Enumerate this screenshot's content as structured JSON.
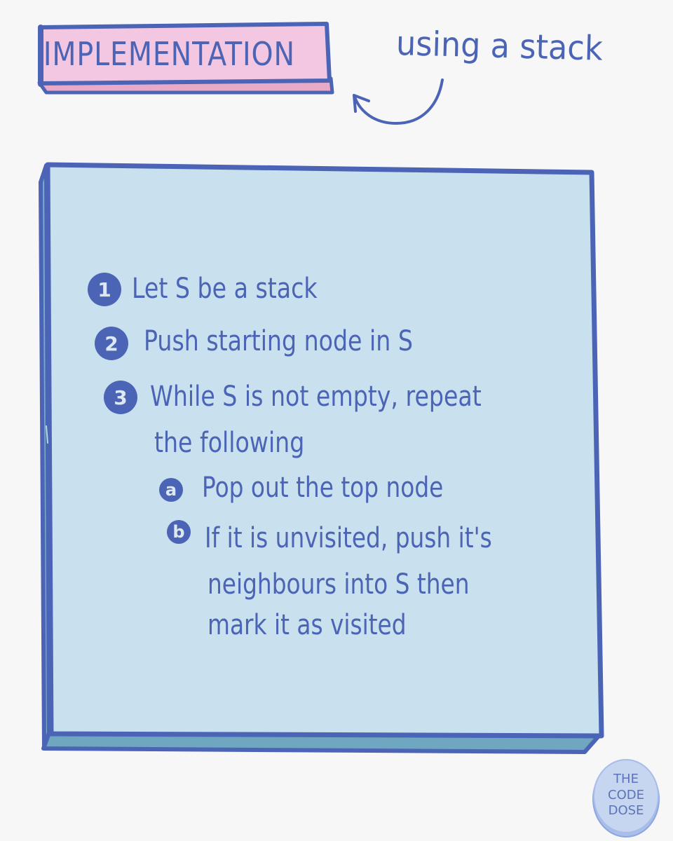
{
  "header": {
    "title": "IMPLEMENTATION",
    "subtitle": "using a stack"
  },
  "steps": [
    {
      "marker": "1",
      "lines": [
        "Let S be a stack"
      ]
    },
    {
      "marker": "2",
      "lines": [
        "Push starting node in S"
      ]
    },
    {
      "marker": "3",
      "lines": [
        "While S is not empty, repeat",
        "the following"
      ]
    }
  ],
  "substeps": [
    {
      "marker": "a",
      "lines": [
        "Pop out the top node"
      ]
    },
    {
      "marker": "b",
      "lines": [
        "If it is unvisited, push it's",
        "neighbours into S then",
        "mark it as visited"
      ]
    }
  ],
  "stamp": {
    "line1": "THE",
    "line2": "CODE",
    "line3": "DOSE"
  },
  "colors": {
    "background": "#f7f7f8",
    "ink": "#4b64b5",
    "board_fill": "#c9e0ee",
    "board_side": "#79a9c7",
    "label_fill": "#f3c7e1"
  }
}
